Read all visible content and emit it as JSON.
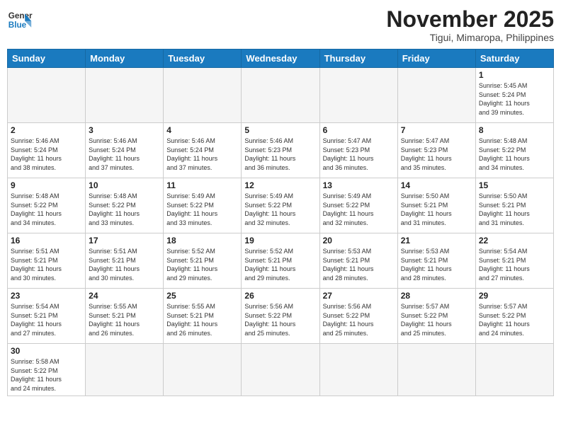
{
  "logo": {
    "general": "General",
    "blue": "Blue"
  },
  "title": "November 2025",
  "location": "Tigui, Mimaropa, Philippines",
  "weekdays": [
    "Sunday",
    "Monday",
    "Tuesday",
    "Wednesday",
    "Thursday",
    "Friday",
    "Saturday"
  ],
  "days": [
    {
      "date": "",
      "info": ""
    },
    {
      "date": "",
      "info": ""
    },
    {
      "date": "",
      "info": ""
    },
    {
      "date": "",
      "info": ""
    },
    {
      "date": "",
      "info": ""
    },
    {
      "date": "",
      "info": ""
    },
    {
      "date": "1",
      "info": "Sunrise: 5:45 AM\nSunset: 5:24 PM\nDaylight: 11 hours\nand 39 minutes."
    },
    {
      "date": "2",
      "info": "Sunrise: 5:46 AM\nSunset: 5:24 PM\nDaylight: 11 hours\nand 38 minutes."
    },
    {
      "date": "3",
      "info": "Sunrise: 5:46 AM\nSunset: 5:24 PM\nDaylight: 11 hours\nand 37 minutes."
    },
    {
      "date": "4",
      "info": "Sunrise: 5:46 AM\nSunset: 5:24 PM\nDaylight: 11 hours\nand 37 minutes."
    },
    {
      "date": "5",
      "info": "Sunrise: 5:46 AM\nSunset: 5:23 PM\nDaylight: 11 hours\nand 36 minutes."
    },
    {
      "date": "6",
      "info": "Sunrise: 5:47 AM\nSunset: 5:23 PM\nDaylight: 11 hours\nand 36 minutes."
    },
    {
      "date": "7",
      "info": "Sunrise: 5:47 AM\nSunset: 5:23 PM\nDaylight: 11 hours\nand 35 minutes."
    },
    {
      "date": "8",
      "info": "Sunrise: 5:48 AM\nSunset: 5:22 PM\nDaylight: 11 hours\nand 34 minutes."
    },
    {
      "date": "9",
      "info": "Sunrise: 5:48 AM\nSunset: 5:22 PM\nDaylight: 11 hours\nand 34 minutes."
    },
    {
      "date": "10",
      "info": "Sunrise: 5:48 AM\nSunset: 5:22 PM\nDaylight: 11 hours\nand 33 minutes."
    },
    {
      "date": "11",
      "info": "Sunrise: 5:49 AM\nSunset: 5:22 PM\nDaylight: 11 hours\nand 33 minutes."
    },
    {
      "date": "12",
      "info": "Sunrise: 5:49 AM\nSunset: 5:22 PM\nDaylight: 11 hours\nand 32 minutes."
    },
    {
      "date": "13",
      "info": "Sunrise: 5:49 AM\nSunset: 5:22 PM\nDaylight: 11 hours\nand 32 minutes."
    },
    {
      "date": "14",
      "info": "Sunrise: 5:50 AM\nSunset: 5:21 PM\nDaylight: 11 hours\nand 31 minutes."
    },
    {
      "date": "15",
      "info": "Sunrise: 5:50 AM\nSunset: 5:21 PM\nDaylight: 11 hours\nand 31 minutes."
    },
    {
      "date": "16",
      "info": "Sunrise: 5:51 AM\nSunset: 5:21 PM\nDaylight: 11 hours\nand 30 minutes."
    },
    {
      "date": "17",
      "info": "Sunrise: 5:51 AM\nSunset: 5:21 PM\nDaylight: 11 hours\nand 30 minutes."
    },
    {
      "date": "18",
      "info": "Sunrise: 5:52 AM\nSunset: 5:21 PM\nDaylight: 11 hours\nand 29 minutes."
    },
    {
      "date": "19",
      "info": "Sunrise: 5:52 AM\nSunset: 5:21 PM\nDaylight: 11 hours\nand 29 minutes."
    },
    {
      "date": "20",
      "info": "Sunrise: 5:53 AM\nSunset: 5:21 PM\nDaylight: 11 hours\nand 28 minutes."
    },
    {
      "date": "21",
      "info": "Sunrise: 5:53 AM\nSunset: 5:21 PM\nDaylight: 11 hours\nand 28 minutes."
    },
    {
      "date": "22",
      "info": "Sunrise: 5:54 AM\nSunset: 5:21 PM\nDaylight: 11 hours\nand 27 minutes."
    },
    {
      "date": "23",
      "info": "Sunrise: 5:54 AM\nSunset: 5:21 PM\nDaylight: 11 hours\nand 27 minutes."
    },
    {
      "date": "24",
      "info": "Sunrise: 5:55 AM\nSunset: 5:21 PM\nDaylight: 11 hours\nand 26 minutes."
    },
    {
      "date": "25",
      "info": "Sunrise: 5:55 AM\nSunset: 5:21 PM\nDaylight: 11 hours\nand 26 minutes."
    },
    {
      "date": "26",
      "info": "Sunrise: 5:56 AM\nSunset: 5:22 PM\nDaylight: 11 hours\nand 25 minutes."
    },
    {
      "date": "27",
      "info": "Sunrise: 5:56 AM\nSunset: 5:22 PM\nDaylight: 11 hours\nand 25 minutes."
    },
    {
      "date": "28",
      "info": "Sunrise: 5:57 AM\nSunset: 5:22 PM\nDaylight: 11 hours\nand 25 minutes."
    },
    {
      "date": "29",
      "info": "Sunrise: 5:57 AM\nSunset: 5:22 PM\nDaylight: 11 hours\nand 24 minutes."
    },
    {
      "date": "30",
      "info": "Sunrise: 5:58 AM\nSunset: 5:22 PM\nDaylight: 11 hours\nand 24 minutes."
    },
    {
      "date": "",
      "info": ""
    },
    {
      "date": "",
      "info": ""
    },
    {
      "date": "",
      "info": ""
    },
    {
      "date": "",
      "info": ""
    },
    {
      "date": "",
      "info": ""
    },
    {
      "date": "",
      "info": ""
    }
  ]
}
